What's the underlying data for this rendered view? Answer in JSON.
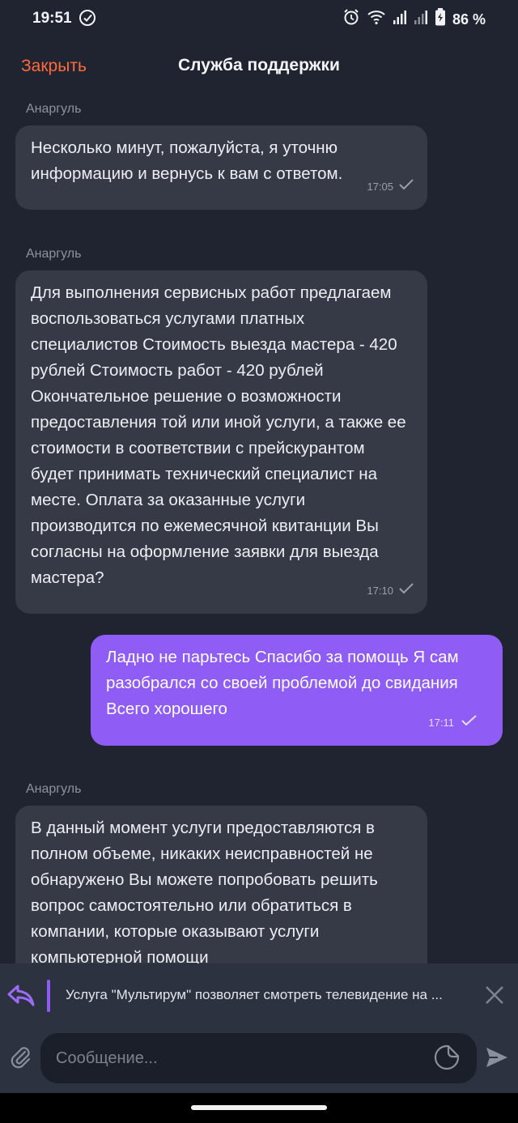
{
  "status_bar": {
    "time": "19:51",
    "battery": "86 %",
    "icons": [
      "check-circle-icon",
      "alarm-icon",
      "wifi-icon",
      "signal-icon",
      "signal-icon",
      "battery-icon"
    ]
  },
  "header": {
    "close_label": "Закрыть",
    "title": "Служба поддержки"
  },
  "messages": [
    {
      "sender": "Анаргуль",
      "text": "Несколько минут, пожалуйста, я уточню информацию и вернусь к вам с ответом.",
      "time": "17:05",
      "own": false
    },
    {
      "sender": "Анаргуль",
      "text": "Для выполнения сервисных работ предлагаем воспользоваться услугами платных специалистов Стоимость выезда мастера - 420 рублей Стоимость работ - 420 рублей Окончательное решение о возможности предоставления той или иной услуги, а также ее стоимости в соответствии с прейскурантом будет принимать технический специалист на месте. Оплата за оказанные услуги производится по ежемесячной квитанции Вы согласны на оформление заявки для выезда мастера?",
      "time": "17:10",
      "own": false
    },
    {
      "sender": "",
      "text": "Ладно не парьтесь Спасибо за помощь Я сам разобрался со своей проблемой до свидания Всего хорошего",
      "time": "17:11",
      "own": true
    },
    {
      "sender": "Анаргуль",
      "text": "В данный момент услуги предоставляются в полном объеме, никаких неисправностей не обнаружено Вы можете попробовать решить вопрос самостоятельно или обратиться в компании, которые оказывают услуги компьютерной помощи",
      "time": "",
      "own": false
    }
  ],
  "reply_preview": {
    "text": "Услуга \"Мультирум\" позволяет смотреть телевидение на ..."
  },
  "composer": {
    "placeholder": "Сообщение..."
  },
  "colors": {
    "background": "#1f2430",
    "incoming_bubble": "#353a46",
    "outgoing_bubble": "#8f5cf6",
    "accent_close": "#ff6a3d"
  }
}
